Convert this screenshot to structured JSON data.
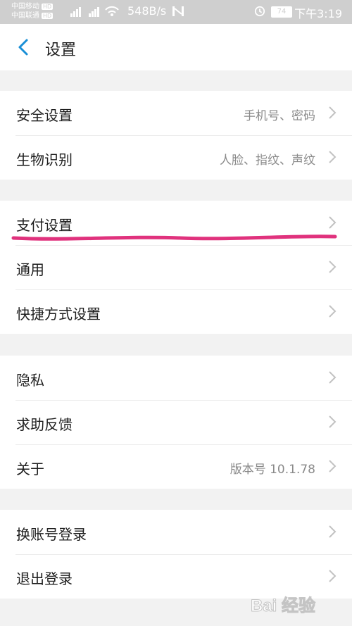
{
  "status_bar": {
    "carrier1": "中国移动",
    "carrier2": "中国联通",
    "hd_label": "HD",
    "net_speed": "548B/s",
    "battery": "74",
    "time": "下午3:19"
  },
  "header": {
    "title": "设置"
  },
  "groups": [
    {
      "items": [
        {
          "label": "安全设置",
          "value": "手机号、密码"
        },
        {
          "label": "生物识别",
          "value": "人脸、指纹、声纹"
        }
      ]
    },
    {
      "items": [
        {
          "label": "支付设置",
          "value": ""
        },
        {
          "label": "通用",
          "value": ""
        },
        {
          "label": "快捷方式设置",
          "value": ""
        }
      ]
    },
    {
      "items": [
        {
          "label": "隐私",
          "value": ""
        },
        {
          "label": "求助反馈",
          "value": ""
        },
        {
          "label": "关于",
          "value": "版本号 10.1.78"
        }
      ]
    },
    {
      "items": [
        {
          "label": "换账号登录",
          "value": ""
        },
        {
          "label": "退出登录",
          "value": ""
        }
      ]
    }
  ],
  "watermark": {
    "text": "Bai 经验"
  },
  "colors": {
    "accent": "#1a8fd6",
    "highlight": "#e0327d"
  }
}
